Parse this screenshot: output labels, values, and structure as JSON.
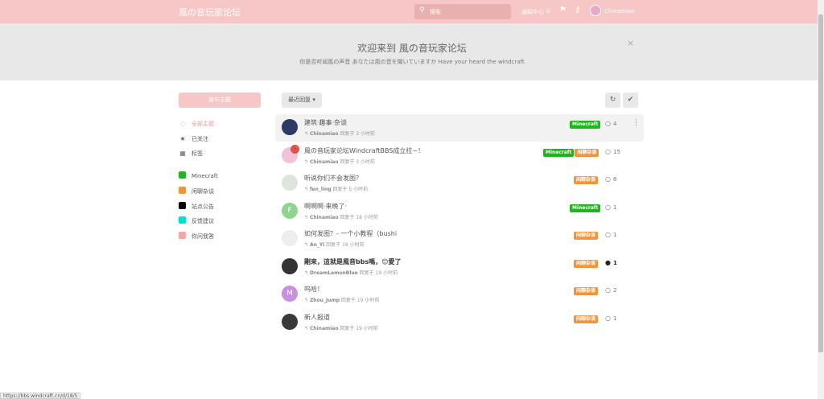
{
  "header": {
    "brand": "風の音玩家论坛",
    "search_placeholder": "搜索",
    "notification_label": "通知中心",
    "notification_count": "0",
    "username": "Chinamiao"
  },
  "hero": {
    "title": "欢迎来到 風の音玩家论坛",
    "subtitle": "你是否听闻風の声音 あなたは風の音を聞いていますか Have your heard the windcraft",
    "close": "×"
  },
  "sidebar": {
    "new_discussion": "发布主题",
    "nav": [
      {
        "label": "全部主题",
        "icon": "comments-icon",
        "glyph": "◌"
      },
      {
        "label": "已关注",
        "icon": "star-icon",
        "glyph": "★"
      },
      {
        "label": "标签",
        "icon": "grid-icon",
        "glyph": "▦"
      }
    ],
    "tags": [
      {
        "label": "Minecraft",
        "color": "#1fb51f"
      },
      {
        "label": "闲聊杂谈",
        "color": "#f0953a"
      },
      {
        "label": "站点公告",
        "color": "#000000"
      },
      {
        "label": "反馈建议",
        "color": "#00e0d0"
      },
      {
        "label": "你问我答",
        "color": "#f4a6a6"
      }
    ]
  },
  "toolbar": {
    "sort_label": "最近回复",
    "refresh_icon": "refresh-icon",
    "mark_read_icon": "check-icon"
  },
  "colors": {
    "minecraft": "#1fb51f",
    "chat": "#f0953a",
    "header": "#f7c6c6"
  },
  "discussions": [
    {
      "title": "建筑·趣事·杂谈",
      "user": "Chinamiao",
      "meta": "回复于 3 小时前",
      "tags": [
        "Minecraft"
      ],
      "count": "4",
      "avatar_color": "#2b3a67",
      "avatar_letter": "",
      "pinned": false,
      "bold": false
    },
    {
      "title": "風の音玩家论坛WindcraftBBS成立拉~！",
      "user": "Chinamiao",
      "meta": "回复于 3 小时前",
      "tags": [
        "Minecraft",
        "闲聊杂谈"
      ],
      "count": "15",
      "avatar_color": "#f3c1d9",
      "avatar_letter": "",
      "pinned": true,
      "bold": false
    },
    {
      "title": "听说你们不会发图？",
      "user": "fen_ling",
      "meta": "回复于 5 小时前",
      "tags": [
        "闲聊杂谈"
      ],
      "count": "8",
      "avatar_color": "#dde5dd",
      "avatar_letter": "",
      "pinned": false,
      "bold": false
    },
    {
      "title": "啊啊啊·来晚了·",
      "user": "Chinamiao",
      "meta": "回复于 18 小时前",
      "tags": [
        "Minecraft"
      ],
      "count": "1",
      "avatar_color": "#8fd48f",
      "avatar_letter": "F",
      "pinned": false,
      "bold": false
    },
    {
      "title": "如何发图？- 一个小教程（bushi",
      "user": "An_Yi",
      "meta": "回复于 19 小时前",
      "tags": [
        "闲聊杂谈"
      ],
      "count": "1",
      "avatar_color": "#eeeeee",
      "avatar_letter": "",
      "pinned": false,
      "bold": false
    },
    {
      "title": "剛來，這就是風音bbs嗎，😊愛了",
      "user": "DreamLemonBlue",
      "meta": "回复于 19 小时前",
      "tags": [
        "闲聊杂谈"
      ],
      "count": "1",
      "avatar_color": "#333333",
      "avatar_letter": "",
      "pinned": false,
      "bold": true
    },
    {
      "title": "呜哈！",
      "user": "Zhou_Jump",
      "meta": "回复于 19 小时前",
      "tags": [
        "闲聊杂谈"
      ],
      "count": "2",
      "avatar_color": "#c98fe0",
      "avatar_letter": "M",
      "pinned": false,
      "bold": false
    },
    {
      "title": "新人报道",
      "user": "Chinamiao",
      "meta": "回复于 19 小时前",
      "tags": [
        "闲聊杂谈"
      ],
      "count": "1",
      "avatar_color": "#3a3a3a",
      "avatar_letter": "",
      "pinned": false,
      "bold": false
    }
  ],
  "status_url": "https://bbs.windcraft.cn/d/18/5"
}
